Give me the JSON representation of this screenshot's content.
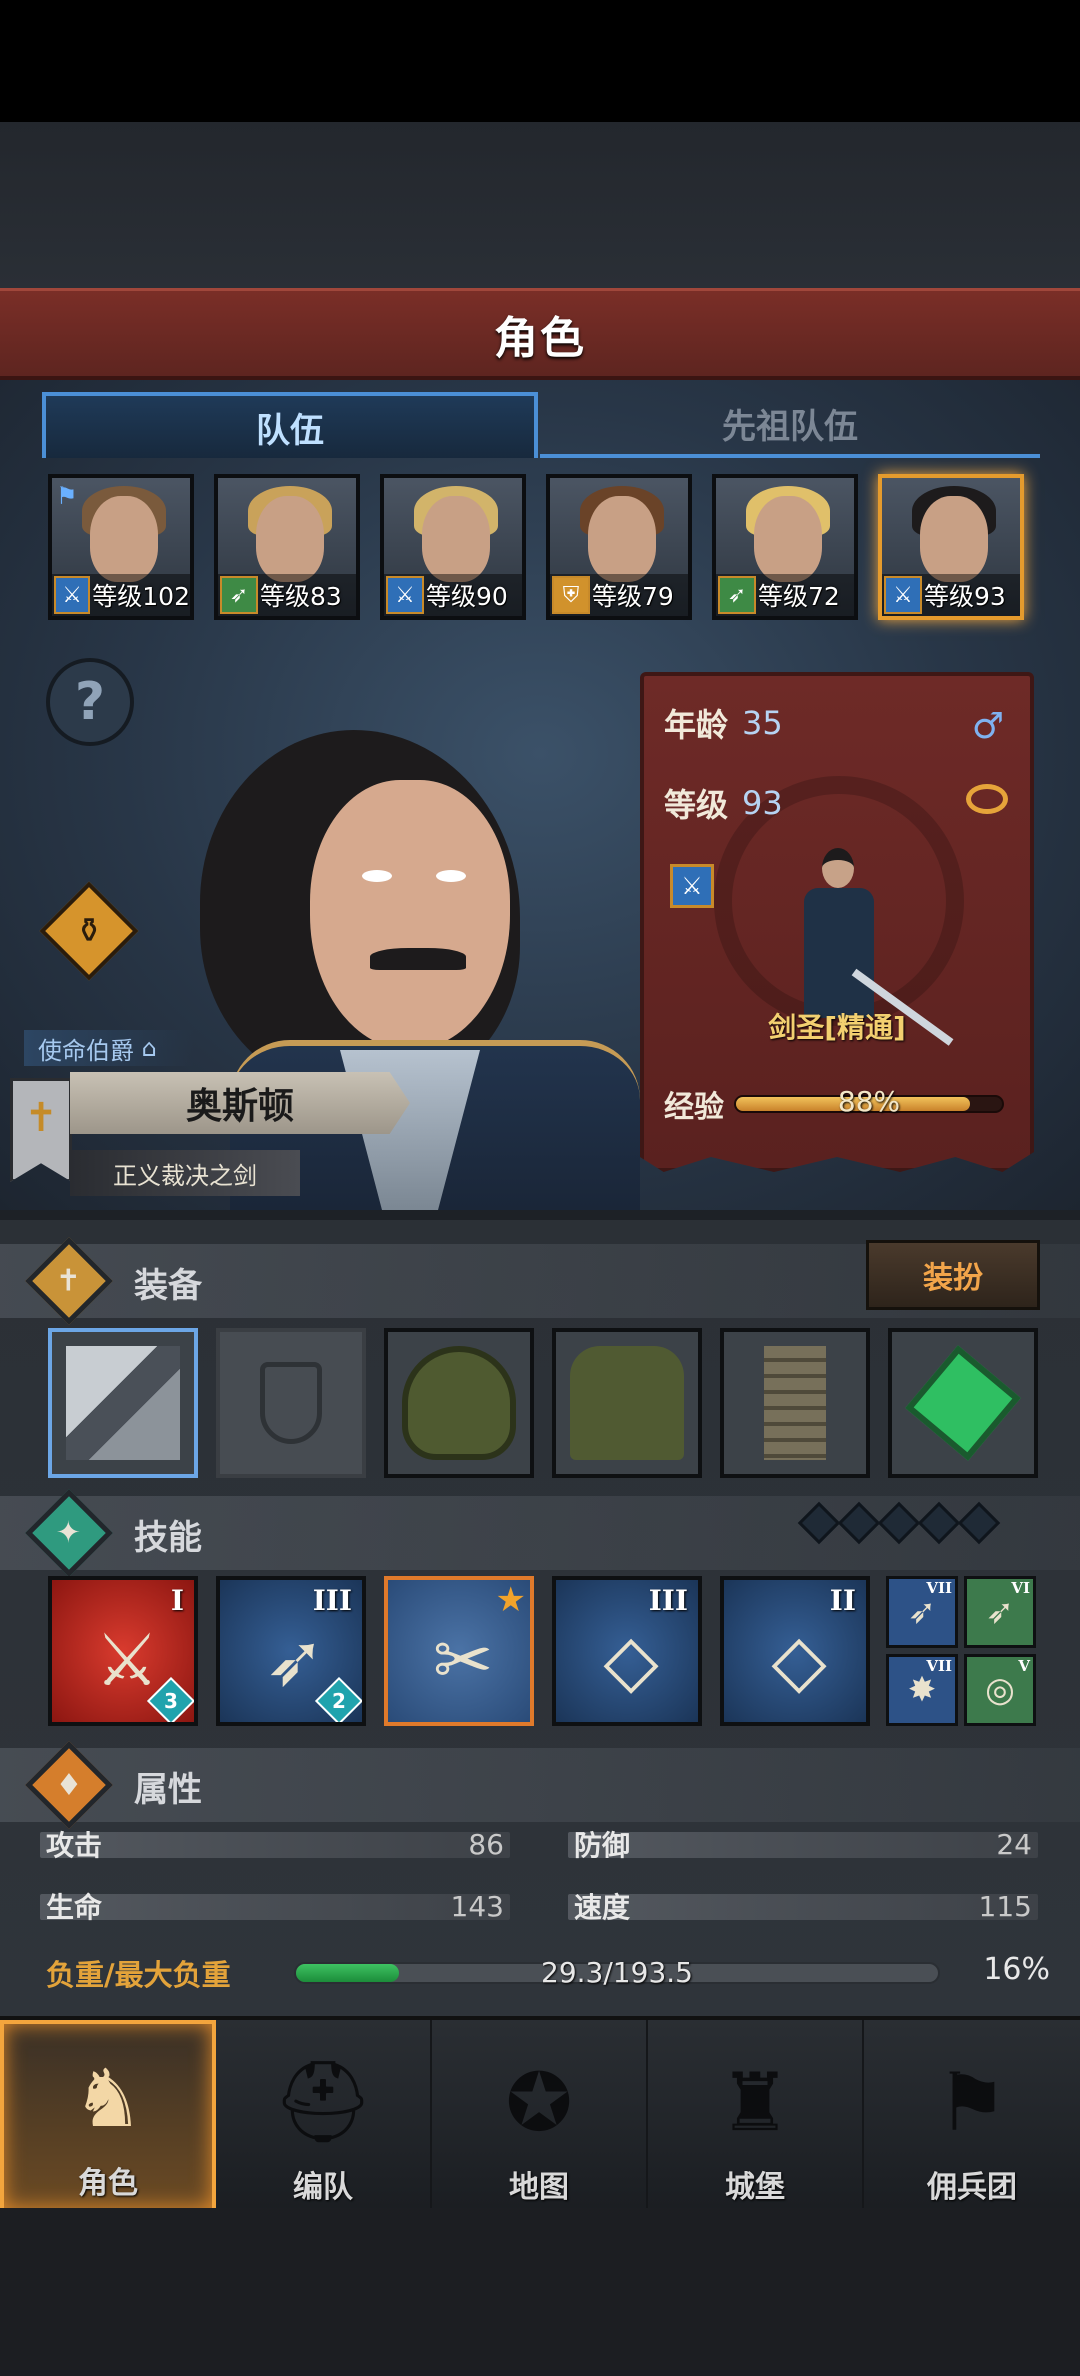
{
  "header": {
    "title": "角色"
  },
  "tabs": [
    {
      "label": "队伍",
      "active": true
    },
    {
      "label": "先祖队伍",
      "active": false
    }
  ],
  "party": [
    {
      "level_text": "等级102",
      "class_icon": "sword-icon",
      "hair": "#7a5a3c",
      "leader": true
    },
    {
      "level_text": "等级83",
      "class_icon": "bow-icon",
      "hair": "#c9a25a"
    },
    {
      "level_text": "等级90",
      "class_icon": "sword-icon",
      "hair": "#d2b46a"
    },
    {
      "level_text": "等级79",
      "class_icon": "shield-icon",
      "hair": "#6a4328"
    },
    {
      "level_text": "等级72",
      "class_icon": "bow-icon",
      "hair": "#e0c06a"
    },
    {
      "level_text": "等级93",
      "class_icon": "sword-icon",
      "hair": "#1d1b1c",
      "selected": true
    }
  ],
  "hero": {
    "title_tag": "使命伯爵",
    "name": "奥斯顿",
    "weapon_title": "正义裁决之剑",
    "age_label": "年龄",
    "age": "35",
    "level_label": "等级",
    "level": "93",
    "gender_symbol": "♂",
    "class_name": "剑圣[精通]",
    "xp_label": "经验",
    "xp_percent_text": "88%",
    "xp_fraction": 0.88
  },
  "equipment": {
    "title": "装备",
    "dress_button": "装扮",
    "slots": [
      {
        "name": "sword-slot",
        "glyph": "⚔",
        "active": true
      },
      {
        "name": "shield-slot",
        "glyph": "⛨",
        "empty": true
      },
      {
        "name": "hood-slot",
        "glyph": "☗"
      },
      {
        "name": "armor-slot",
        "glyph": "👕"
      },
      {
        "name": "boots-slot",
        "glyph": "👢"
      },
      {
        "name": "gem-slot",
        "glyph": "◆"
      }
    ]
  },
  "skills": {
    "title": "技能",
    "items": [
      {
        "rank": "I",
        "badge": "3",
        "style": "red",
        "glyph": "⚔"
      },
      {
        "rank": "III",
        "badge": "2",
        "style": "blue",
        "glyph": "➶"
      },
      {
        "rank": "",
        "star": true,
        "style": "blue",
        "glyph": "✂"
      },
      {
        "rank": "III",
        "style": "blue",
        "glyph": "◇"
      },
      {
        "rank": "II",
        "style": "blue",
        "glyph": "◇"
      }
    ],
    "mini": [
      {
        "rank": "VII",
        "glyph": "➶",
        "bg": "#2d5287"
      },
      {
        "rank": "VI",
        "glyph": "➶",
        "bg": "#3d7a4c"
      },
      {
        "rank": "VII",
        "glyph": "✸",
        "bg": "#2d5287"
      },
      {
        "rank": "V",
        "glyph": "◎",
        "bg": "#3d7a4c"
      }
    ]
  },
  "attributes": {
    "title": "属性",
    "attack_label": "攻击",
    "attack": "86",
    "defense_label": "防御",
    "defense": "24",
    "life_label": "生命",
    "life": "143",
    "speed_label": "速度",
    "speed": "115",
    "load_label": "负重/最大负重",
    "load_text": "29.3/193.5",
    "load_percent": "16%",
    "load_fraction": 0.16
  },
  "nav": [
    {
      "label": "角色",
      "active": true,
      "glyph": "♞"
    },
    {
      "label": "编队",
      "glyph": "⛑"
    },
    {
      "label": "地图",
      "glyph": "✪"
    },
    {
      "label": "城堡",
      "glyph": "♜"
    },
    {
      "label": "佣兵团",
      "glyph": "⚑"
    }
  ],
  "colors": {
    "accent_blue": "#4b8fd6",
    "gold": "#e59b2d",
    "card_red": "#6e2a27"
  }
}
